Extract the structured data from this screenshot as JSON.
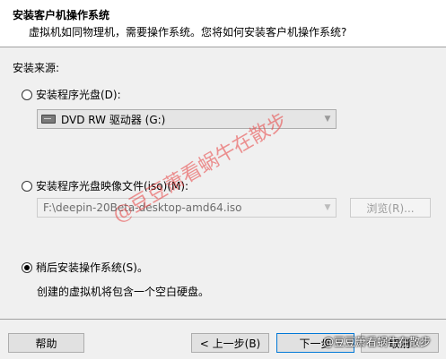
{
  "header": {
    "title": "安装客户机操作系统",
    "subtitle": "虚拟机如同物理机，需要操作系统。您将如何安装客户机操作系统?"
  },
  "source_label": "安装来源:",
  "options": {
    "disc": {
      "label": "安装程序光盘(D):",
      "selected": false,
      "drive_value": "DVD RW 驱动器 (G:)"
    },
    "iso": {
      "label": "安装程序光盘映像文件(iso)(M):",
      "selected": false,
      "path_value": "F:\\deepin-20Beta-desktop-amd64.iso",
      "browse_label": "浏览(R)..."
    },
    "later": {
      "label": "稍后安装操作系统(S)。",
      "selected": true,
      "hint": "创建的虚拟机将包含一个空白硬盘。"
    }
  },
  "footer": {
    "help_label": "帮助",
    "back_label": "< 上一步(B)",
    "next_label": "下一步",
    "cancel_label": "取消"
  },
  "watermark": {
    "text": "@豆豆萧看蜗牛在散步",
    "corner": "@豆豆萧看蜗牛在散步"
  },
  "icons": {
    "drive": "dvd-drive-icon",
    "dropdown": "chevron-down-icon"
  }
}
